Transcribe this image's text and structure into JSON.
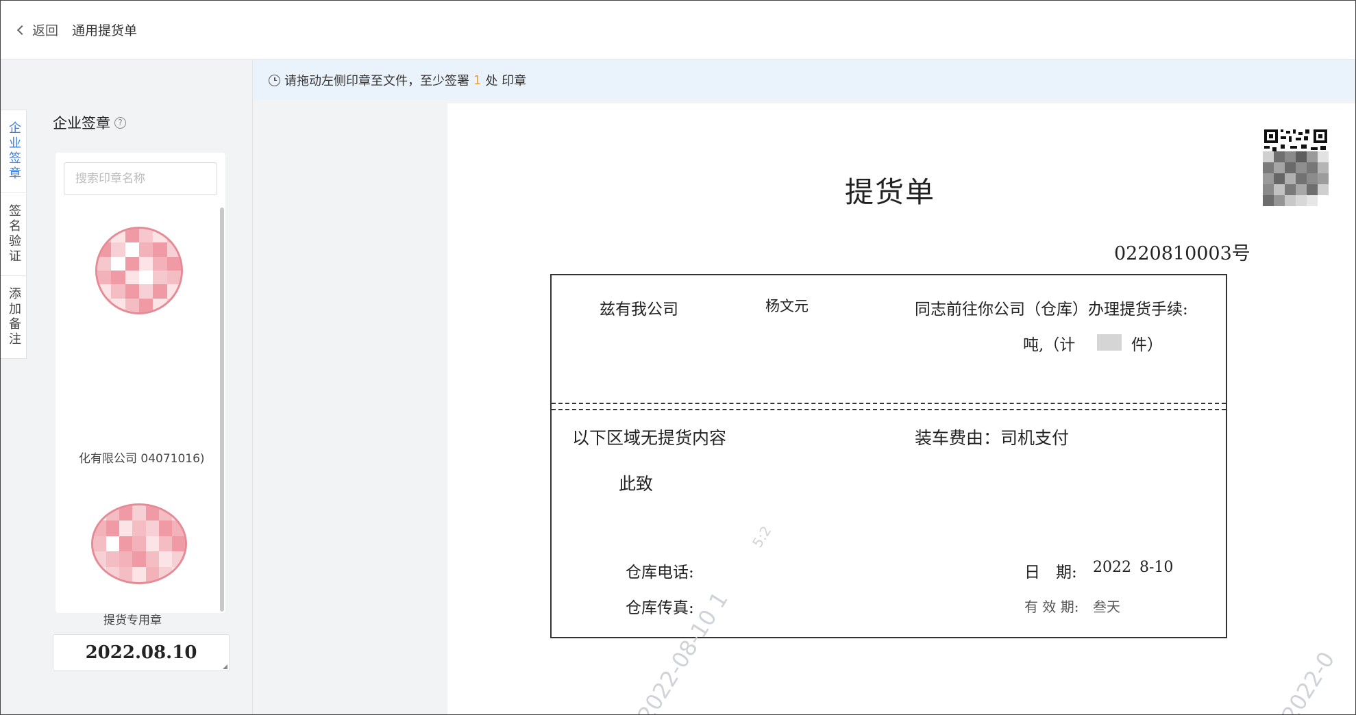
{
  "header": {
    "back_label": "返回",
    "title": "通用提货单"
  },
  "left_tabs": [
    {
      "label": "企业签章",
      "active": true
    },
    {
      "label": "签名验证",
      "active": false
    },
    {
      "label": "添加备注",
      "active": false
    }
  ],
  "seal_panel": {
    "title": "企业签章",
    "search_placeholder": "搜索印章名称",
    "seals": [
      {
        "caption": "化有限公司 04071016)"
      },
      {
        "caption": "提货专用章"
      }
    ],
    "date_stamp": "2022.08.10"
  },
  "notice": {
    "prefix": "请拖动左侧印章至文件，至少签署",
    "count": "1",
    "suffix": "处 印章"
  },
  "document": {
    "title": "提货单",
    "number": "0220810003号",
    "line1_left": "兹有我公司",
    "line1_name": "杨文元",
    "line1_right": "同志前往你公司（仓库）办理提货手续:",
    "line2_dun": "吨,（计",
    "line2_jian": "件）",
    "no_content": "以下区域无提货内容",
    "loading_fee": "装车费由：司机支付",
    "closing": "此致",
    "phone_label": "仓库电话:",
    "fax_label": "仓库传真:",
    "date_label": "日　期:",
    "date_value": "2022",
    "date_value2": "8-10",
    "valid_label": "有 效 期:",
    "valid_value": "叁天",
    "watermarks": [
      "2022-08-10 1",
      "2022-0",
      "5:2"
    ]
  }
}
